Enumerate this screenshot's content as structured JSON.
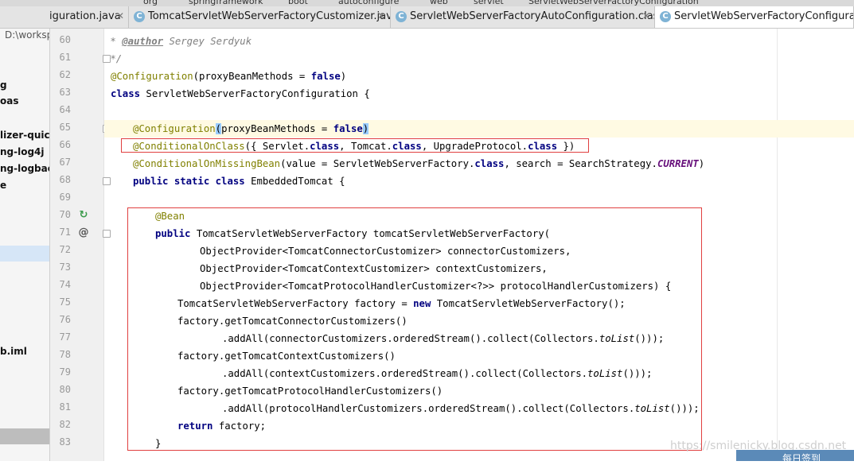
{
  "breadcrumbs": [
    "org",
    "springframework",
    "boot",
    "autoconfigure",
    "web",
    "servlet",
    "ServletWebServerFactoryConfiguration"
  ],
  "tabs": [
    {
      "label": "iguration.java",
      "active": false
    },
    {
      "label": "TomcatServletWebServerFactoryCustomizer.java",
      "active": false
    },
    {
      "label": "ServletWebServerFactoryAutoConfiguration.class",
      "active": false
    },
    {
      "label": "ServletWebServerFactoryConfiguration",
      "active": true
    }
  ],
  "project_panel": {
    "path": "D:\\worksp",
    "items": [
      "g",
      "oas",
      "lizer-quick",
      "ng-log4j",
      "ng-logbac",
      "e",
      "b.iml"
    ]
  },
  "line_numbers": [
    "60",
    "61",
    "62",
    "63",
    "64",
    "65",
    "66",
    "67",
    "68",
    "69",
    "70",
    "71",
    "72",
    "73",
    "74",
    "75",
    "76",
    "77",
    "78",
    "79",
    "80",
    "81",
    "82",
    "83"
  ],
  "code": {
    "l60_tag": "@author",
    "l60_name": " Sergey Serdyuk",
    "l61": " */",
    "l62_ann": "@Configuration",
    "l62_rest": "(proxyBeanMethods = ",
    "l62_false": "false",
    "l63_class": "class",
    "l63_rest": " ServletWebServerFactoryConfiguration {",
    "l65_ann": "@Configuration",
    "l65_rest": "proxyBeanMethods = ",
    "l65_false": "false",
    "l66_ann": "@ConditionalOnClass",
    "l66_a": "({ Servlet.",
    "l66_b": ", Tomcat.",
    "l66_c": ", UpgradeProtocol.",
    "l66_d": " })",
    "kw_class": "class",
    "l67_ann": "@ConditionalOnMissingBean",
    "l67_a": "(value = ServletWebServerFactory.",
    "l67_b": ", search = SearchStrategy.",
    "l67_const": "CURRENT",
    "l67_c": ")",
    "l68_kw": "public static class",
    "l68_rest": " EmbeddedTomcat {",
    "l70_ann": "@Bean",
    "l71_kw": "public",
    "l71_rest": " TomcatServletWebServerFactory tomcatServletWebServerFactory(",
    "l72": "ObjectProvider<TomcatConnectorCustomizer> connectorCustomizers,",
    "l73": "ObjectProvider<TomcatContextCustomizer> contextCustomizers,",
    "l74": "ObjectProvider<TomcatProtocolHandlerCustomizer<?>> protocolHandlerCustomizers) {",
    "l75_a": "TomcatServletWebServerFactory factory = ",
    "l75_new": "new",
    "l75_b": " TomcatServletWebServerFactory();",
    "l76": "factory.getTomcatConnectorCustomizers()",
    "l77_a": ".addAll(connectorCustomizers.orderedStream().collect(Collectors.",
    "to_list": "toList",
    "l77_b": "()));",
    "l78": "factory.getTomcatContextCustomizers()",
    "l79_a": ".addAll(contextCustomizers.orderedStream().collect(Collectors.",
    "l79_b": "()));",
    "l80": "factory.getTomcatProtocolHandlerCustomizers()",
    "l81_a": ".addAll(protocolHandlerCustomizers.orderedStream().collect(Collectors.",
    "l81_b": "()));",
    "l82_kw": "return",
    "l82_rest": " factory;",
    "l83": "}"
  },
  "watermark": "https://smilenicky.blog.csdn.net",
  "badge_text": "每日签到",
  "colors": {
    "keyword": "#000080",
    "annotation": "#808000",
    "comment": "#808080",
    "highlight_box": "#e04040"
  }
}
